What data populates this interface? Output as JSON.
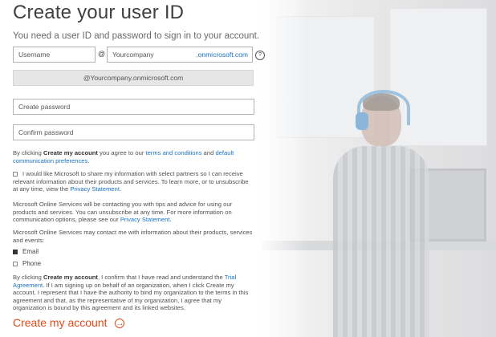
{
  "title": "Create your user ID",
  "subtitle": "You need a user ID and password to sign in to your account.",
  "fields": {
    "username_placeholder": "Username",
    "at_symbol": "@",
    "company_placeholder": "Yourcompany",
    "company_suffix": ".onmicrosoft.com",
    "help_icon": "?",
    "preview": "@Yourcompany.onmicrosoft.com",
    "create_password_placeholder": "Create password",
    "confirm_password_placeholder": "Confirm password"
  },
  "terms": {
    "prefix": "By clicking ",
    "bold": "Create my account",
    "middle": " you agree to our ",
    "terms_link": "terms and conditions",
    "and": " and ",
    "prefs_link": "default communication preferences",
    "end": "."
  },
  "partners": {
    "text": "I would like Microsoft to share my information with select partners so I can receive relevant information about their products and services. To learn more, or to unsubscribe at any time, view the ",
    "link": "Privacy Statement",
    "end": "."
  },
  "online_services": {
    "text": "Microsoft Online Services will be contacting you with tips and advice for using our products and services. You can unsubscribe at any time. For more information on communication options, please see our ",
    "link": "Privacy Statement",
    "end": "."
  },
  "contact": {
    "text": "Microsoft Online Services may contact me with information about their products, services and events:",
    "email": "Email",
    "phone": "Phone",
    "email_checked": true,
    "phone_checked": false
  },
  "agreement": {
    "prefix": "By clicking ",
    "bold": "Create my account",
    "middle": ", I confirm that I have read and understand the ",
    "link": "Trial Agreement",
    "rest": ". If I am signing up on behalf of an organization, when I click Create my account, I represent that I have the authority to bind my organization to the terms in this agreement and that, as the representative of my organization, I agree that my organization is bound by this agreement and its linked websites."
  },
  "cta": {
    "label": "Create my account",
    "icon": "→"
  },
  "colors": {
    "accent": "#e04a1c",
    "link": "#1a73c6",
    "text": "#404040"
  },
  "icons": [
    "help-icon",
    "arrow-circle-right-icon",
    "checkbox-icon"
  ]
}
